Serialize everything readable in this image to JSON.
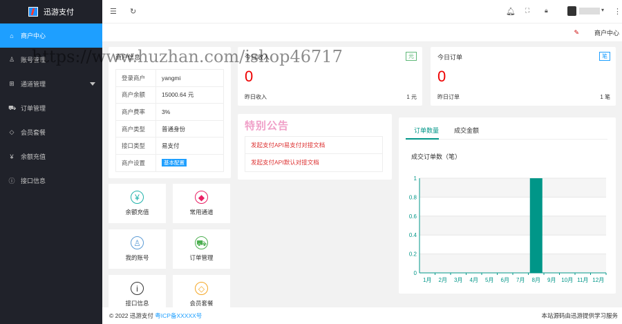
{
  "app": {
    "title": "迅游支付"
  },
  "sidebar": {
    "items": [
      {
        "label": "商户中心",
        "icon": "home-icon",
        "glyph": "⌂"
      },
      {
        "label": "账号管理",
        "icon": "user-icon",
        "glyph": "♙"
      },
      {
        "label": "通道管理",
        "icon": "channel-icon",
        "glyph": "⊞"
      },
      {
        "label": "订单管理",
        "icon": "cart-icon",
        "glyph": "⛟"
      },
      {
        "label": "会员套餐",
        "icon": "diamond-icon",
        "glyph": "◇"
      },
      {
        "label": "余额充值",
        "icon": "yen-icon",
        "glyph": "¥"
      },
      {
        "label": "接口信息",
        "icon": "info-icon",
        "glyph": "ⓘ"
      }
    ]
  },
  "tabbar": {
    "current": "商户中心"
  },
  "merchant": {
    "title": "商户信息",
    "rows": [
      {
        "label": "登录商户",
        "value": "yangmi"
      },
      {
        "label": "商户余额",
        "value": "15000.64 元"
      },
      {
        "label": "商户费率",
        "value": "3%"
      },
      {
        "label": "商户类型",
        "value": "普通身份"
      },
      {
        "label": "接口类型",
        "value": "易支付"
      }
    ],
    "settings_label": "商户设置",
    "settings_button": "基本配置"
  },
  "income": {
    "title": "今日收入",
    "badge": "元",
    "value": "0",
    "yesterday_label": "昨日收入",
    "yesterday_value": "1 元"
  },
  "orders": {
    "title": "今日订单",
    "badge": "笔",
    "value": "0",
    "yesterday_label": "昨日订单",
    "yesterday_value": "1 笔"
  },
  "notice": {
    "title": "特别公告",
    "links": [
      "发起支付API易支付对接文档",
      "发起支付API默认对接文档"
    ]
  },
  "tiles": [
    {
      "label": "余额充值",
      "icon": "yen-icon",
      "glyph": "¥",
      "color": "#20b2aa"
    },
    {
      "label": "常用通道",
      "icon": "grid-icon",
      "glyph": "◆",
      "color": "#e91e63"
    },
    {
      "label": "我的账号",
      "icon": "user-icon",
      "glyph": "♙",
      "color": "#5b9bd5"
    },
    {
      "label": "订单管理",
      "icon": "cart-icon",
      "glyph": "⛟",
      "color": "#4caf50"
    },
    {
      "label": "接口信息",
      "icon": "info-icon",
      "glyph": "i",
      "color": "#333333"
    },
    {
      "label": "会员套餐",
      "icon": "diamond-icon",
      "glyph": "◇",
      "color": "#f5a623"
    }
  ],
  "chart_tabs": [
    "订单数量",
    "成交金额"
  ],
  "chart_data": {
    "type": "bar",
    "title": "成交订单数（笔）",
    "categories": [
      "1月",
      "2月",
      "3月",
      "4月",
      "5月",
      "6月",
      "7月",
      "8月",
      "9月",
      "10月",
      "11月",
      "12月"
    ],
    "values": [
      0,
      0,
      0,
      0,
      0,
      0,
      0,
      1,
      0,
      0,
      0,
      0
    ],
    "ylim": [
      0,
      1
    ],
    "yticks": [
      "0",
      "0.2",
      "0.4",
      "0.6",
      "0.8",
      "1"
    ],
    "color": "#009688"
  },
  "footer": {
    "copyright": "© 2022 迅游支付",
    "icp": "粤ICP备XXXXX号",
    "right": "本站源码由迅游提供学习服务"
  },
  "watermark": "https://www.huzhan.com/ishop46717"
}
